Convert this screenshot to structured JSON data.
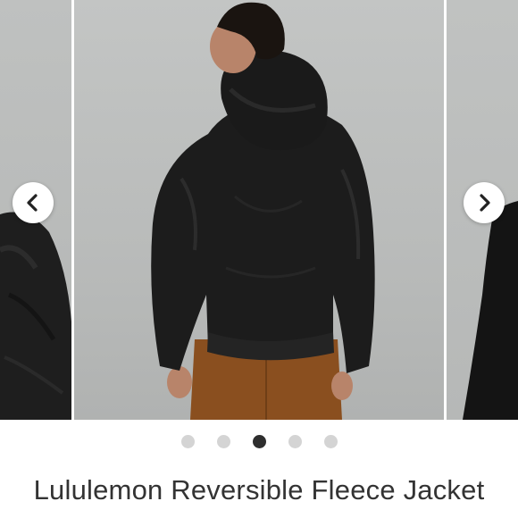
{
  "carousel": {
    "prev_label": "Previous image",
    "next_label": "Next image",
    "image_count": 5,
    "active_index": 2,
    "slides": [
      {
        "name": "slide-previous",
        "subject": "black fleece jacket detail"
      },
      {
        "name": "slide-current",
        "subject": "model wearing black fleece hooded jacket, back view, rust pants"
      },
      {
        "name": "slide-next",
        "subject": "black jacket edge"
      }
    ]
  },
  "product": {
    "title": "Lululemon Reversible Fleece Jacket"
  },
  "colors": {
    "jacket": "#1c1c1c",
    "pants": "#8a4f1f",
    "background": "#b9bbba",
    "dot_active": "#2e2e2e",
    "dot_inactive": "#d4d4d4"
  },
  "icons": {
    "prev": "chevron-left-icon",
    "next": "chevron-right-icon"
  }
}
